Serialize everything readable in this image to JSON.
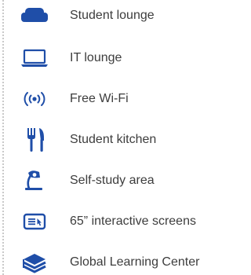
{
  "icon_color": "#1f4ea8",
  "text_color": "#3d3d3d",
  "amenities": [
    {
      "icon": "sofa-icon",
      "label": "Student lounge"
    },
    {
      "icon": "laptop-icon",
      "label": "IT lounge"
    },
    {
      "icon": "wifi-icon",
      "label": "Free Wi-Fi"
    },
    {
      "icon": "fork-knife-icon",
      "label": "Student kitchen"
    },
    {
      "icon": "desk-lamp-icon",
      "label": "Self-study area"
    },
    {
      "icon": "interactive-screen-icon",
      "label": "65” interactive screens"
    },
    {
      "icon": "books-icon",
      "label": "Global Learning Center"
    }
  ]
}
